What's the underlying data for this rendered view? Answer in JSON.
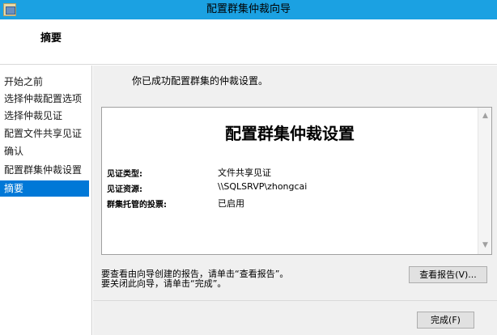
{
  "window": {
    "title": "配置群集仲裁向导"
  },
  "header": {
    "title": "摘要"
  },
  "sidebar": {
    "items": [
      {
        "label": "开始之前"
      },
      {
        "label": "选择仲裁配置选项"
      },
      {
        "label": "选择仲裁见证"
      },
      {
        "label": "配置文件共享见证"
      },
      {
        "label": "确认"
      },
      {
        "label": "配置群集仲裁设置"
      },
      {
        "label": "摘要"
      }
    ]
  },
  "main": {
    "intro": "你已成功配置群集的仲裁设置。",
    "report": {
      "title": "配置群集仲裁设置",
      "rows": [
        {
          "label": "见证类型:",
          "value": "文件共享见证"
        },
        {
          "label": "见证资源:",
          "value": "\\\\SQLSRVP\\zhongcai"
        },
        {
          "label": "群集托管的投票:",
          "value": "已启用"
        }
      ]
    },
    "hint_report": "要查看由向导创建的报告，请单击“查看报告”。",
    "hint_finish": "要关闭此向导，请单击“完成”。",
    "view_report_button": "查看报告(V)...",
    "finish_button": "完成(F)"
  },
  "icons": {
    "app": "cluster-wizard-icon",
    "scroll_up": "scroll-up-arrow-icon",
    "scroll_down": "scroll-down-arrow-icon"
  },
  "colors": {
    "titlebar": "#1ba1e2",
    "selection": "#0078d7",
    "panel": "#f0f0f0"
  }
}
